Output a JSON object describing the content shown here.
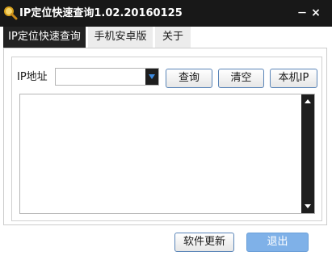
{
  "window": {
    "title": "IP定位快速查询1.02.20160125",
    "minimize_label": "－",
    "close_label": "×",
    "accent_color": "#181818"
  },
  "tabs": [
    {
      "label": "IP定位快速查询",
      "active": true
    },
    {
      "label": "手机安卓版",
      "active": false
    },
    {
      "label": "关于",
      "active": false
    }
  ],
  "query_form": {
    "ip_label": "IP地址",
    "ip_value": "",
    "query_button": "查询",
    "clear_button": "清空",
    "local_ip_button": "本机IP"
  },
  "result": {
    "text": ""
  },
  "footer": {
    "update_button": "软件更新",
    "exit_button": "退出",
    "exit_color": "#7fb1e8"
  },
  "icons": {
    "app": "magnifier-icon",
    "combo": "chevron-down-icon",
    "scroll_up": "arrow-up-icon",
    "scroll_down": "arrow-down-icon"
  }
}
